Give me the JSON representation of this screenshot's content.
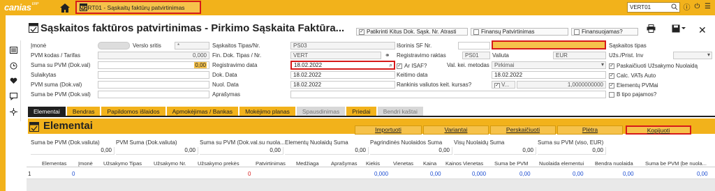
{
  "topbar": {
    "logo": "canias",
    "logo_sup": "ERP",
    "tab_label": "VERT01 - Sąskaitų faktūrų patvirtinimas",
    "search_value": "VERT01"
  },
  "header": {
    "title": "Sąskaitos faktūros patvirtinimas - Pirkimo Sąskaita Faktūra...",
    "checks": [
      {
        "label": "Patikrinti Kitus Dok. Sąsk. Nr. Atrasti",
        "checked": true
      },
      {
        "label": "Finansų Patvirtinimas",
        "checked": false
      },
      {
        "label": "Finansuojamas?",
        "checked": false
      }
    ]
  },
  "form": {
    "col1": {
      "labels": [
        "Įmonė",
        "PVM kodas / Tarifas",
        "Suma su PVM (Dok.val)",
        "Sulaikytas",
        "PVM suma (Dok.val)",
        "Suma be PVM (Dok.val)"
      ],
      "values": [
        "",
        "0,000",
        "0,00",
        "",
        "",
        ""
      ],
      "verslo_label": "Verslo sritis",
      "verslo_value": "*"
    },
    "col2": {
      "labels": [
        "Sąskaitos Tipas/Nr.",
        "Fin. Dok. Tipas / Nr.",
        "Registravimo data",
        "Dok. Data",
        "Nuol. Data",
        "Aprašymas"
      ],
      "values": [
        "PS03",
        "VERT",
        "18.02.2022",
        "18.02.2022",
        "18.02.2022",
        ""
      ]
    },
    "col3": {
      "labels": [
        "Išorinis SF Nr.",
        "Registravimo raktas",
        "Ar ISAF?",
        "Keitimo data",
        "Rankinis valiutos keit. kursas?"
      ],
      "valiuta_label": "Valiuta",
      "reg_value": "PS01",
      "val_value": "EUR",
      "metodas_label": "Val. kei. metodas",
      "metodas_value": "Pirkimai",
      "keit_value": "18.02.2022",
      "v_value": "V...",
      "rate_value": "1,0000000000"
    },
    "col4": {
      "labels": [
        "Sąskaitos tipas",
        "Užs./Prist. Inv",
        "Paskaičiuoti Užsakymo Nuolaidą",
        "Calc. VATs Auto",
        "Elementų PVMai",
        "B tipo pajamos?"
      ]
    }
  },
  "tabs": [
    {
      "label": "Elementai",
      "state": "active"
    },
    {
      "label": "Bendras",
      "state": ""
    },
    {
      "label": "Papildomos išlaidos",
      "state": ""
    },
    {
      "label": "Apmokėjimas / Bankas",
      "state": ""
    },
    {
      "label": "Mokėjimo planas",
      "state": ""
    },
    {
      "label": "Spausdinimas",
      "state": "dis"
    },
    {
      "label": "Priedai",
      "state": ""
    },
    {
      "label": "Bendri kaštai",
      "state": "dis"
    }
  ],
  "section": {
    "title": "Elementai",
    "buttons": [
      "Importuoti",
      "Variantai",
      "Perskaičiuoti",
      "Plėtra",
      "Kopijuoti"
    ]
  },
  "totals": {
    "labels": [
      "Suma be PVM (Dok.valiuta)",
      "PVM Suma (Dok.valiuta)",
      "Suma su PVM (Dok.val.su nuola...",
      "Elementų Nuolaidų Suma",
      "Pagrindinės Nuolaidos Suma",
      "Visų Nuolaidų Suma",
      "Suma su PVM (viso, EUR)"
    ],
    "values": [
      "0,00",
      "0,00",
      "0,00",
      "0,00",
      "0,00",
      "0,00",
      "0,00"
    ]
  },
  "grid": {
    "headers": [
      "Elementas",
      "Įmonė",
      "Užsakymo Tipas",
      "Užsakymo Nr.",
      "Užsakymo prekės",
      "Patvirtinimas",
      "Medžiaga",
      "Aprašymas",
      "Kiekis",
      "Vienetas",
      "Kaina",
      "Kainos Vienetas",
      "Suma be PVM",
      "Nuolaida elementui",
      "Bendra nuolaida",
      "Suma be PVM (be nuola..."
    ],
    "row": [
      "1",
      "0",
      "",
      "",
      "0",
      "",
      "",
      "",
      "0,000",
      "",
      "0,00",
      "0,000",
      "0,00",
      "0,00",
      "0,00",
      "0,00"
    ]
  }
}
